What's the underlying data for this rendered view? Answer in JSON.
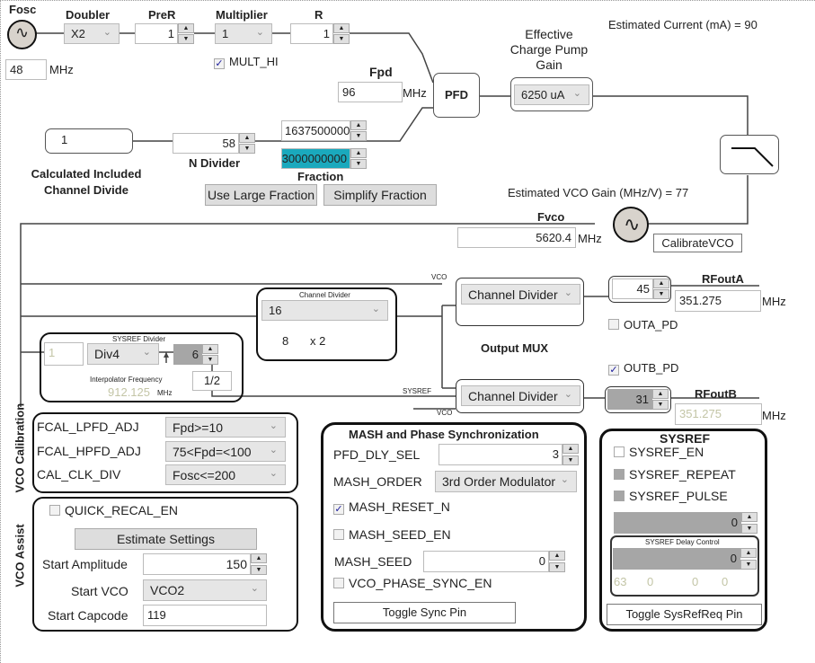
{
  "reference": {
    "label": "Fosc",
    "fosc_value": "48",
    "unit": "MHz"
  },
  "doubler": {
    "label": "Doubler",
    "value": "X2"
  },
  "pre_r": {
    "label": "PreR",
    "value": "1"
  },
  "multiplier": {
    "label": "Multiplier",
    "value": "1",
    "mult_hi_label": "MULT_HI",
    "mult_hi_checked": true
  },
  "r_divider": {
    "label": "R",
    "value": "1"
  },
  "fpd": {
    "label": "Fpd",
    "value": "96",
    "unit": "MHz"
  },
  "pfd": {
    "label": "PFD"
  },
  "charge_pump": {
    "label_line1": "Effective",
    "label_line2": "Charge Pump",
    "label_line3": "Gain",
    "value": "6250 uA"
  },
  "estimated_current": "Estimated Current (mA) = 90",
  "channel_divide_calc": {
    "value": "1",
    "label_line1": "Calculated Included",
    "label_line2": "Channel Divide"
  },
  "n_divider": {
    "label": "N Divider",
    "value": "58"
  },
  "fraction": {
    "label": "Fraction",
    "numerator": "1637500000",
    "denominator": "3000000000"
  },
  "buttons": {
    "use_large_fraction": "Use Large Fraction",
    "simplify_fraction": "Simplify Fraction",
    "calibrate_vco": "CalibrateVCO",
    "estimate_settings": "Estimate Settings",
    "toggle_sync_pin": "Toggle Sync Pin",
    "toggle_sysrefreq_pin": "Toggle SysRefReq Pin"
  },
  "estimated_vco_gain": "Estimated VCO Gain (MHz/V) = 77",
  "fvco": {
    "label": "Fvco",
    "value": "5620.4",
    "unit": "MHz"
  },
  "channel_divider": {
    "title": "Channel  Divider",
    "value": "16",
    "part1": "8",
    "part2": "x 2"
  },
  "sysref_divider": {
    "title": "SYSREF Divider",
    "input": "1",
    "select": "Div4",
    "spin": "6",
    "half": "1/2",
    "interp_label": "Interpolator Frequency",
    "interp_value": "912.125",
    "interp_unit": "MHz"
  },
  "output_mux": {
    "label": "Output MUX",
    "vco_label_a": "VCO",
    "sysref_label": "SYSREF",
    "vco_label_b": "VCO",
    "mux_a": "Channel Divider",
    "mux_b": "Channel Divider"
  },
  "rfouta": {
    "label": "RFoutA",
    "power": "45",
    "freq": "351.275",
    "unit": "MHz",
    "pd_label": "OUTA_PD",
    "pd_checked": false
  },
  "rfoutb": {
    "label": "RFoutB",
    "power": "31",
    "freq": "351.275",
    "unit": "MHz",
    "pd_label": "OUTB_PD",
    "pd_checked": true
  },
  "vco_calibration": {
    "section_label": "VCO Calibration",
    "rows": [
      {
        "label": "FCAL_LPFD_ADJ",
        "value": "Fpd>=10"
      },
      {
        "label": "FCAL_HPFD_ADJ",
        "value": "75<Fpd=<100"
      },
      {
        "label": "CAL_CLK_DIV",
        "value": "Fosc<=200"
      }
    ]
  },
  "vco_assist": {
    "section_label": "VCO Assist",
    "quick_recal_label": "QUICK_RECAL_EN",
    "quick_recal_checked": false,
    "start_amplitude_label": "Start Amplitude",
    "start_amplitude": "150",
    "start_vco_label": "Start VCO",
    "start_vco": "VCO2",
    "start_capcode_label": "Start Capcode",
    "start_capcode": "119"
  },
  "mash": {
    "title": "MASH and Phase Synchronization",
    "pfd_dly_sel_label": "PFD_DLY_SEL",
    "pfd_dly_sel": "3",
    "mash_order_label": "MASH_ORDER",
    "mash_order": "3rd Order Modulator",
    "mash_reset_n_label": "MASH_RESET_N",
    "mash_reset_n_checked": true,
    "mash_seed_en_label": "MASH_SEED_EN",
    "mash_seed_en_checked": false,
    "mash_seed_label": "MASH_SEED",
    "mash_seed": "0",
    "vco_phase_sync_label": "VCO_PHASE_SYNC_EN",
    "vco_phase_sync_checked": false
  },
  "sysref": {
    "title": "SYSREF",
    "en_label": "SYSREF_EN",
    "repeat_label": "SYSREF_REPEAT",
    "pulse_label": "SYSREF_PULSE",
    "spin": "0",
    "delay_title": "SYSREF Delay Control",
    "delay_spin": "0",
    "delay_values": [
      "63",
      "0",
      "0",
      "0"
    ]
  },
  "colors": {
    "fraction_highlight": "#1aa9bd",
    "disabled_gray": "#a6a6a6",
    "check": "#1b1b9c"
  }
}
